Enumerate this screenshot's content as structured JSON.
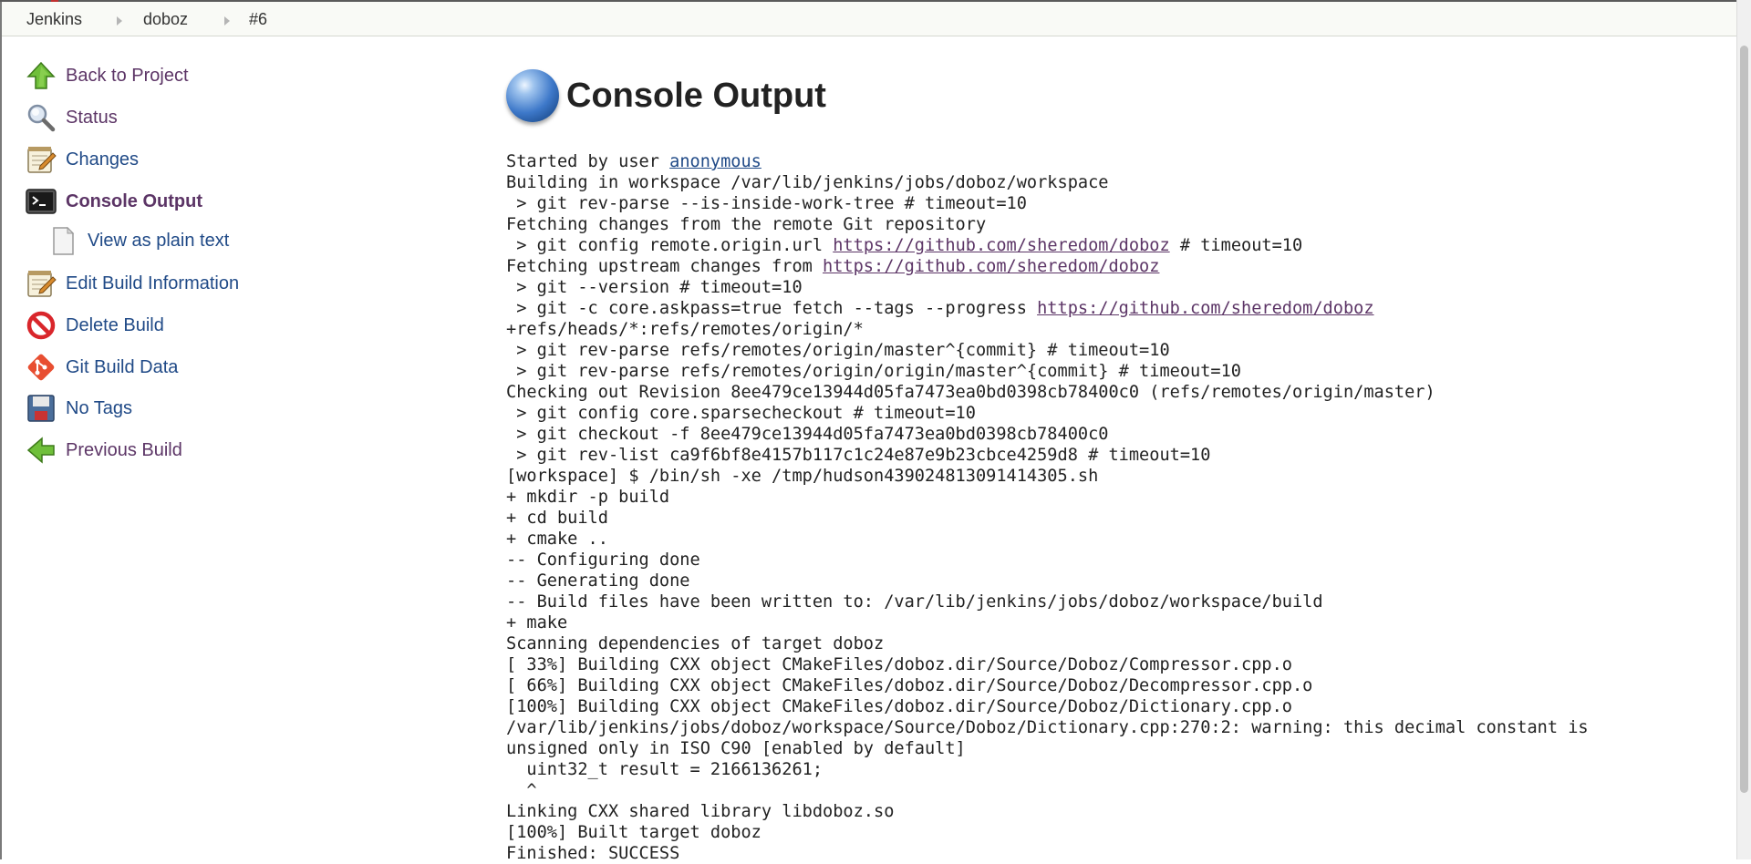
{
  "breadcrumbs": [
    "Jenkins",
    "doboz",
    "#6"
  ],
  "tasks": {
    "back": "Back to Project",
    "status": "Status",
    "changes": "Changes",
    "console": "Console Output",
    "plain": "View as plain text",
    "edit": "Edit Build Information",
    "delete": "Delete Build",
    "git": "Git Build Data",
    "tags": "No Tags",
    "previous": "Previous Build"
  },
  "icons": {
    "back": "up-arrow-icon",
    "status": "magnifier-icon",
    "changes": "notepad-icon",
    "console": "terminal-icon",
    "plain": "document-icon",
    "edit": "notepad-icon",
    "delete": "no-entry-icon",
    "git": "git-icon",
    "tags": "floppy-disk-icon",
    "previous": "left-arrow-icon"
  },
  "page_title": "Console Output",
  "console": {
    "l01_pre": "Started by user ",
    "l01_link": "anonymous",
    "l02": "Building in workspace /var/lib/jenkins/jobs/doboz/workspace",
    "l03": " > git rev-parse --is-inside-work-tree # timeout=10",
    "l04": "Fetching changes from the remote Git repository",
    "l05_pre": " > git config remote.origin.url ",
    "l05_link": "https://github.com/sheredom/doboz",
    "l05_post": " # timeout=10",
    "l06_pre": "Fetching upstream changes from ",
    "l06_link": "https://github.com/sheredom/doboz",
    "l07": " > git --version # timeout=10",
    "l08_pre": " > git -c core.askpass=true fetch --tags --progress ",
    "l08_link": "https://github.com/sheredom/doboz",
    "l09": "+refs/heads/*:refs/remotes/origin/*",
    "l10": " > git rev-parse refs/remotes/origin/master^{commit} # timeout=10",
    "l11": " > git rev-parse refs/remotes/origin/origin/master^{commit} # timeout=10",
    "l12": "Checking out Revision 8ee479ce13944d05fa7473ea0bd0398cb78400c0 (refs/remotes/origin/master)",
    "l13": " > git config core.sparsecheckout # timeout=10",
    "l14": " > git checkout -f 8ee479ce13944d05fa7473ea0bd0398cb78400c0",
    "l15": " > git rev-list ca9f6bf8e4157b117c1c24e87e9b23cbce4259d8 # timeout=10",
    "l16": "[workspace] $ /bin/sh -xe /tmp/hudson439024813091414305.sh",
    "l17": "+ mkdir -p build",
    "l18": "+ cd build",
    "l19": "+ cmake ..",
    "l20": "-- Configuring done",
    "l21": "-- Generating done",
    "l22": "-- Build files have been written to: /var/lib/jenkins/jobs/doboz/workspace/build",
    "l23": "+ make",
    "l24": "Scanning dependencies of target doboz",
    "l25": "[ 33%] Building CXX object CMakeFiles/doboz.dir/Source/Doboz/Compressor.cpp.o",
    "l26": "[ 66%] Building CXX object CMakeFiles/doboz.dir/Source/Doboz/Decompressor.cpp.o",
    "l27": "[100%] Building CXX object CMakeFiles/doboz.dir/Source/Doboz/Dictionary.cpp.o",
    "l28": "/var/lib/jenkins/jobs/doboz/workspace/Source/Doboz/Dictionary.cpp:270:2: warning: this decimal constant is",
    "l29": "unsigned only in ISO C90 [enabled by default]",
    "l30": "  uint32_t result = 2166136261;",
    "l31": "  ^",
    "l32": "Linking CXX shared library libdoboz.so",
    "l33": "[100%] Built target doboz",
    "l34": "Finished: SUCCESS"
  }
}
